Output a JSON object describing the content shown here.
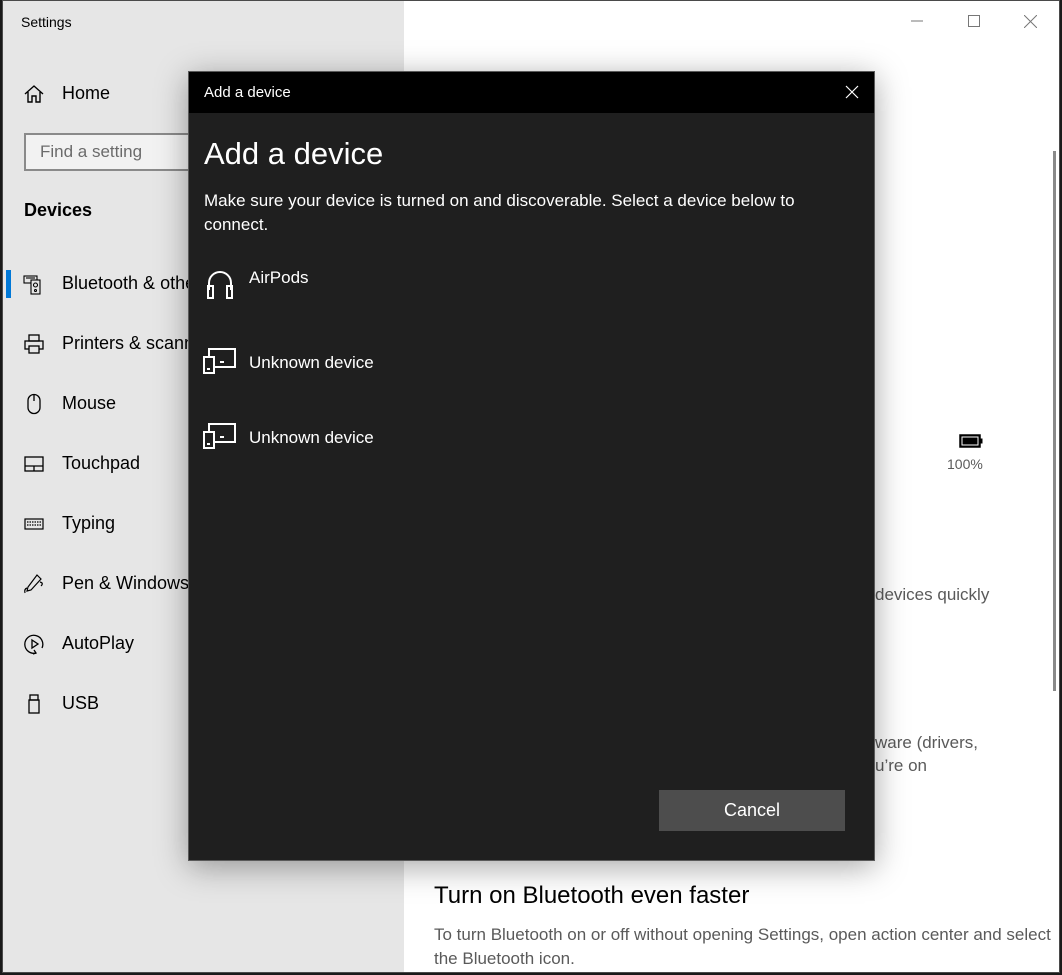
{
  "window": {
    "title": "Settings",
    "controls": {
      "minimize": "minimize",
      "maximize": "maximize",
      "close": "close"
    }
  },
  "sidebar": {
    "home_label": "Home",
    "search_placeholder": "Find a setting",
    "section_title": "Devices",
    "items": [
      {
        "label": "Bluetooth & other devices",
        "icon": "bluetooth-devices-icon",
        "selected": true
      },
      {
        "label": "Printers & scanners",
        "icon": "printer-icon",
        "selected": false
      },
      {
        "label": "Mouse",
        "icon": "mouse-icon",
        "selected": false
      },
      {
        "label": "Touchpad",
        "icon": "touchpad-icon",
        "selected": false
      },
      {
        "label": "Typing",
        "icon": "keyboard-icon",
        "selected": false
      },
      {
        "label": "Pen & Windows Ink",
        "icon": "pen-icon",
        "selected": false
      },
      {
        "label": "AutoPlay",
        "icon": "autoplay-icon",
        "selected": false
      },
      {
        "label": "USB",
        "icon": "usb-icon",
        "selected": false
      }
    ],
    "accent_color": "#0078d7"
  },
  "content": {
    "battery_percent": "100%",
    "partial_texts": [
      "devices quickly",
      "ware (drivers,",
      "u’re on"
    ],
    "tip_title": "Turn on Bluetooth even faster",
    "tip_body": "To turn Bluetooth on or off without opening Settings, open action center and select the Bluetooth icon."
  },
  "dialog": {
    "window_title": "Add a device",
    "heading": "Add a device",
    "description": "Make sure your device is turned on and discoverable. Select a device below to connect.",
    "devices": [
      {
        "name": "AirPods",
        "icon": "headphones-icon"
      },
      {
        "name": "Unknown device",
        "icon": "generic-device-icon"
      },
      {
        "name": "Unknown device",
        "icon": "generic-device-icon"
      }
    ],
    "cancel_label": "Cancel"
  }
}
